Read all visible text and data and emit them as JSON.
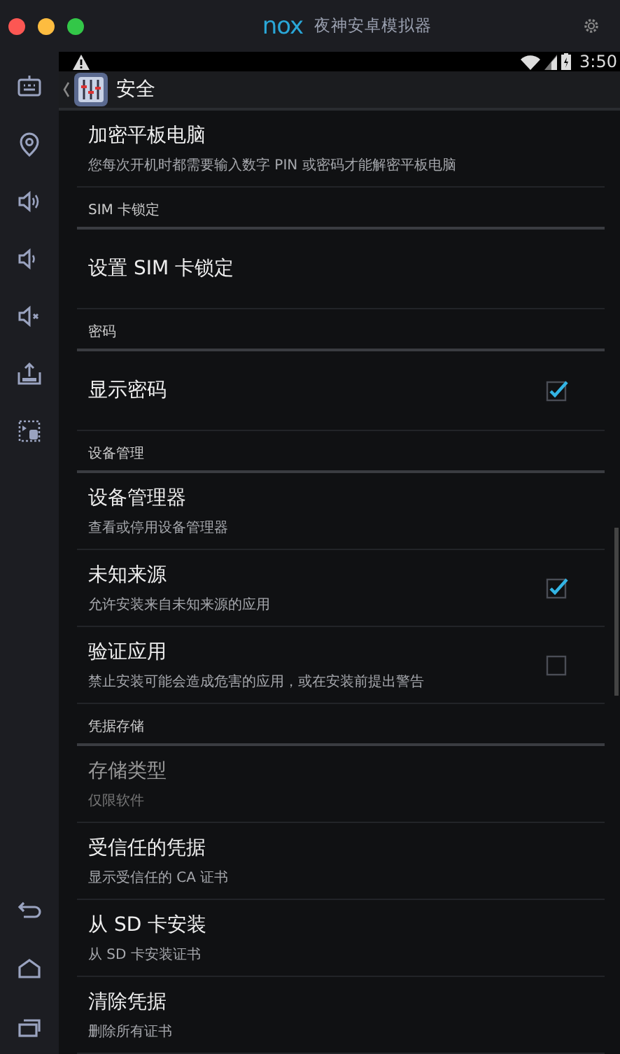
{
  "window": {
    "logo": "nox",
    "title": "夜神安卓模拟器"
  },
  "status_bar": {
    "time": "3:50"
  },
  "action_bar": {
    "title": "安全"
  },
  "list": [
    {
      "kind": "item",
      "title": "加密平板电脑",
      "subtitle": "您每次开机时都需要输入数字 PIN 或密码才能解密平板电脑",
      "disabled": false
    },
    {
      "kind": "header",
      "title": "SIM 卡锁定"
    },
    {
      "kind": "item",
      "title": "设置 SIM 卡锁定",
      "disabled": false
    },
    {
      "kind": "header",
      "title": "密码"
    },
    {
      "kind": "item",
      "title": "显示密码",
      "checked": true,
      "disabled": false
    },
    {
      "kind": "header",
      "title": "设备管理"
    },
    {
      "kind": "item",
      "title": "设备管理器",
      "subtitle": "查看或停用设备管理器",
      "disabled": false
    },
    {
      "kind": "item",
      "title": "未知来源",
      "subtitle": "允许安装来自未知来源的应用",
      "checked": true,
      "disabled": false
    },
    {
      "kind": "item",
      "title": "验证应用",
      "subtitle": "禁止安装可能会造成危害的应用，或在安装前提出警告",
      "checked": false,
      "disabled": false
    },
    {
      "kind": "header",
      "title": "凭据存储"
    },
    {
      "kind": "item",
      "title": "存储类型",
      "subtitle": "仅限软件",
      "disabled": true
    },
    {
      "kind": "item",
      "title": "受信任的凭据",
      "subtitle": "显示受信任的 CA 证书",
      "disabled": false
    },
    {
      "kind": "item",
      "title": "从 SD 卡安装",
      "subtitle": "从 SD 卡安装证书",
      "disabled": false
    },
    {
      "kind": "item",
      "title": "清除凭据",
      "subtitle": "删除所有证书",
      "disabled": false
    }
  ]
}
